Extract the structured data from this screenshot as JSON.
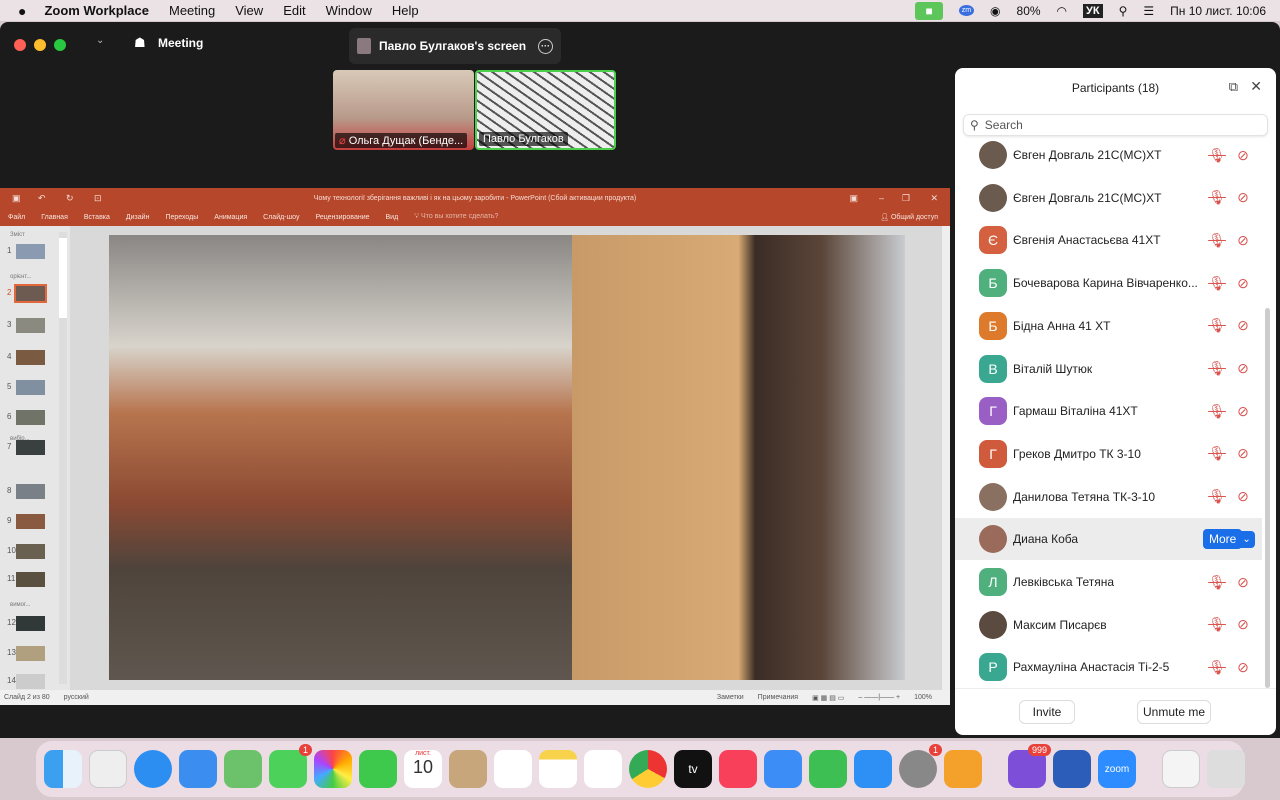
{
  "menubar": {
    "app": "Zoom Workplace",
    "items": [
      "Meeting",
      "View",
      "Edit",
      "Window",
      "Help"
    ],
    "battery": "80%",
    "input_lang": "УК",
    "datetime": "Пн 10 лист.  10:06"
  },
  "zoom": {
    "meeting_label": "Meeting",
    "share_label": "Павло Булгаков's screen",
    "videos": [
      {
        "name": "Ольга Дущак (Бенде..."
      },
      {
        "name": "Павло Булгаков"
      }
    ]
  },
  "ppt": {
    "title": "Чому технології зберігання важливі і як на цьому заробити - PowerPoint (Сбой активации продукта)",
    "tabs": [
      "Файл",
      "Главная",
      "Вставка",
      "Дизайн",
      "Переходы",
      "Анимация",
      "Слайд-шоу",
      "Рецензирование",
      "Вид"
    ],
    "tell_me": "Что вы хотите сделать?",
    "share": "Общий доступ",
    "sections": [
      "Зміст",
      "орієнт...",
      "вибір...",
      "вимог..."
    ],
    "slide_numbers": [
      "1",
      "2",
      "3",
      "4",
      "5",
      "6",
      "7",
      "8",
      "9",
      "10",
      "11",
      "12",
      "13",
      "14"
    ],
    "status_slide": "Слайд 2 из 80",
    "status_lang": "русский",
    "notes": "Заметки",
    "comments": "Примечания",
    "zoom_level": "100%"
  },
  "participants": {
    "title": "Participants (18)",
    "search_placeholder": "Search",
    "more_label": "More",
    "invite": "Invite",
    "unmute": "Unmute me",
    "list": [
      {
        "name": "Євген Довгаль 21С(МС)ХТ",
        "initial": "",
        "color": "#6b5a4e"
      },
      {
        "name": "Євген Довгаль 21С(МС)ХТ",
        "initial": "",
        "color": "#6b5a4e"
      },
      {
        "name": "Євгенія Анастасьєва 41ХТ",
        "initial": "Є",
        "color": "#d4603f"
      },
      {
        "name": "Бочеварова Карина Вівчаренко...",
        "initial": "Б",
        "color": "#4fb07e"
      },
      {
        "name": "Бідна Анна 41 ХТ",
        "initial": "Б",
        "color": "#dd7a2b"
      },
      {
        "name": "Віталій Шутюк",
        "initial": "В",
        "color": "#3aa891"
      },
      {
        "name": "Гармаш Віталіна 41ХТ",
        "initial": "Г",
        "color": "#9a5fc4"
      },
      {
        "name": "Греков Дмитро ТК 3-10",
        "initial": "Г",
        "color": "#cf5a3c"
      },
      {
        "name": "Данилова Тетяна ТК-3-10",
        "initial": "",
        "color": "#8a7060"
      },
      {
        "name": "Диана Коба",
        "initial": "",
        "color": "#9a6a5a"
      },
      {
        "name": "Левківська Тетяна",
        "initial": "Л",
        "color": "#4fb07e"
      },
      {
        "name": "Максим Писарєв",
        "initial": "",
        "color": "#5a4a40"
      },
      {
        "name": "Рахмауліна Анастасія Ті-2-5",
        "initial": "Р",
        "color": "#3aa891"
      }
    ]
  },
  "dock": {
    "calendar_month": "лист.",
    "calendar_day": "10",
    "messages_badge": "1",
    "settings_badge": "1",
    "viber_badge": "999",
    "zoom_label": "zoom",
    "tv_label": "tv"
  }
}
